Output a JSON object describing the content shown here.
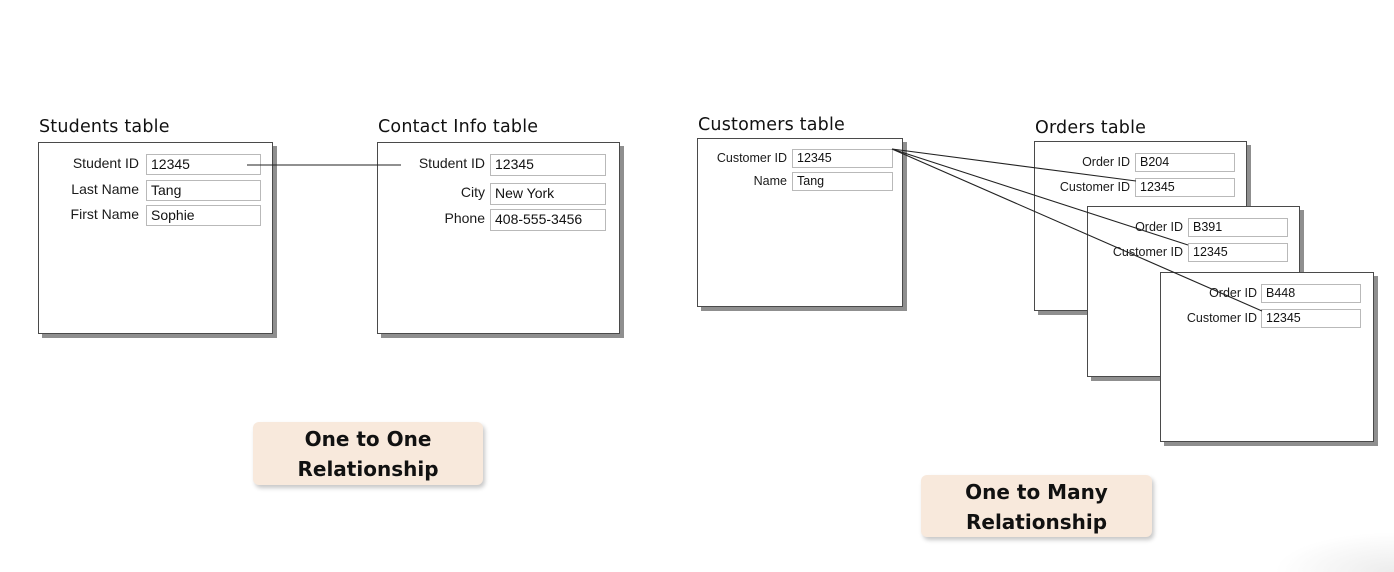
{
  "one_to_one": {
    "students": {
      "title": "Students table",
      "rows": [
        {
          "label": "Student ID",
          "value": "12345"
        },
        {
          "label": "Last Name",
          "value": "Tang"
        },
        {
          "label": "First Name",
          "value": "Sophie"
        }
      ]
    },
    "contact": {
      "title": "Contact Info table",
      "rows": [
        {
          "label": "Student ID",
          "value": "12345"
        },
        {
          "label": "City",
          "value": "New York"
        },
        {
          "label": "Phone",
          "value": "408-555-3456"
        }
      ]
    },
    "caption": [
      "One to One",
      "Relationship"
    ]
  },
  "one_to_many": {
    "customers": {
      "title": "Customers table",
      "rows": [
        {
          "label": "Customer ID",
          "value": "12345"
        },
        {
          "label": "Name",
          "value": "Tang"
        }
      ]
    },
    "orders_title": "Orders table",
    "orders": [
      {
        "rows": [
          {
            "label": "Order ID",
            "value": "B204"
          },
          {
            "label": "Customer ID",
            "value": "12345"
          }
        ]
      },
      {
        "rows": [
          {
            "label": "Order ID",
            "value": "B391"
          },
          {
            "label": "Customer ID",
            "value": "12345"
          }
        ]
      },
      {
        "rows": [
          {
            "label": "Order ID",
            "value": "B448"
          },
          {
            "label": "Customer ID",
            "value": "12345"
          }
        ]
      }
    ],
    "caption": [
      "One to Many",
      "Relationship"
    ]
  },
  "colors": {
    "card_border": "#4a4a4a",
    "card_shadow": "#8f8f8f",
    "field_border": "#b9b9b9",
    "badge_bg": "#f8e9dc"
  }
}
